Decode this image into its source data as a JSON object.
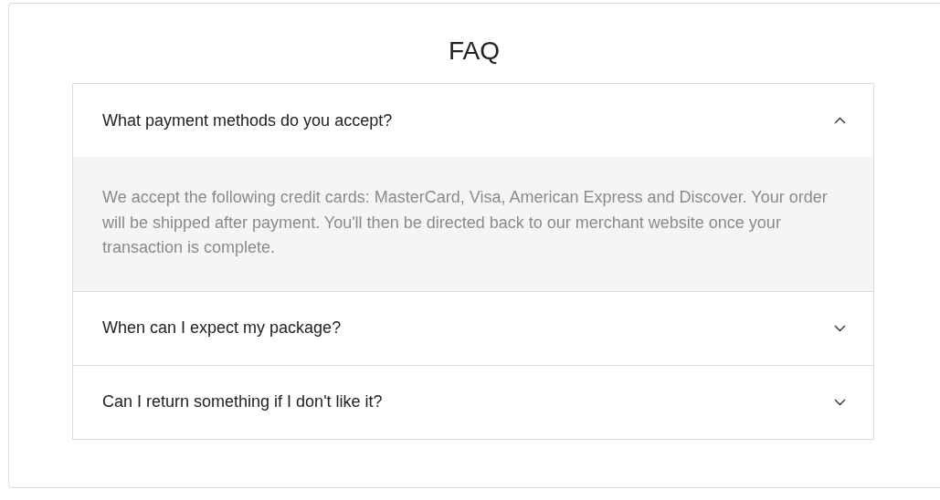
{
  "title": "FAQ",
  "faqs": [
    {
      "question": "What payment methods do you accept?",
      "expanded": true,
      "answer": "We accept the following credit cards: MasterCard, Visa, American Express and Discover. Your order will be shipped after payment. You'll then be directed back to our merchant website once your transaction is complete."
    },
    {
      "question": "When can I expect my package?",
      "expanded": false
    },
    {
      "question": "Can I return something if I don't like it?",
      "expanded": false
    }
  ]
}
